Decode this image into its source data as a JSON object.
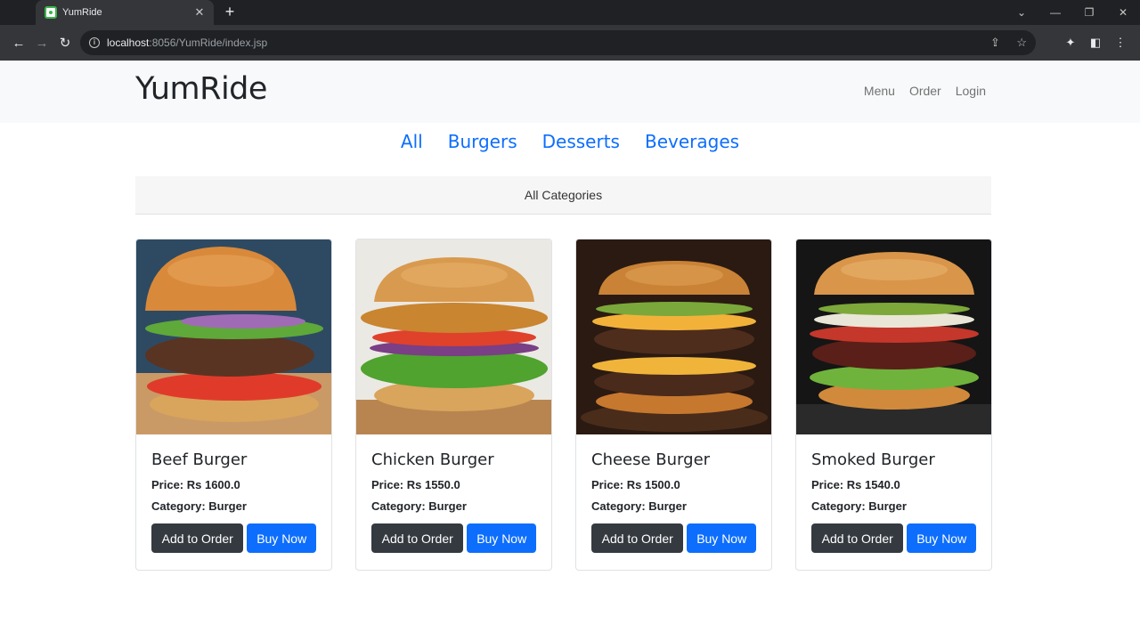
{
  "browser": {
    "tab_title": "YumRide",
    "url_host": "localhost",
    "url_rest": ":8056/YumRide/index.jsp",
    "icons": [
      "back-icon",
      "forward-icon",
      "reload-icon",
      "info-icon",
      "share-icon",
      "star-icon",
      "extensions-icon",
      "sidepanel-icon",
      "menu-icon"
    ]
  },
  "site": {
    "brand": "YumRide",
    "nav": [
      "Menu",
      "Order",
      "Login"
    ],
    "categories": [
      "All",
      "Burgers",
      "Desserts",
      "Beverages"
    ],
    "category_header": "All Categories"
  },
  "products": [
    {
      "name": "Beef Burger",
      "price": "Price: Rs 1600.0",
      "category": "Category: Burger",
      "add_label": "Add to Order",
      "buy_label": "Buy Now"
    },
    {
      "name": "Chicken Burger",
      "price": "Price: Rs 1550.0",
      "category": "Category: Burger",
      "add_label": "Add to Order",
      "buy_label": "Buy Now"
    },
    {
      "name": "Cheese Burger",
      "price": "Price: Rs 1500.0",
      "category": "Category: Burger",
      "add_label": "Add to Order",
      "buy_label": "Buy Now"
    },
    {
      "name": "Smoked Burger",
      "price": "Price: Rs 1540.0",
      "category": "Category: Burger",
      "add_label": "Add to Order",
      "buy_label": "Buy Now"
    }
  ],
  "colors": {
    "accent": "#0d6efd",
    "dark_button": "#343a40",
    "navbar_bg": "#f8f9fa"
  }
}
